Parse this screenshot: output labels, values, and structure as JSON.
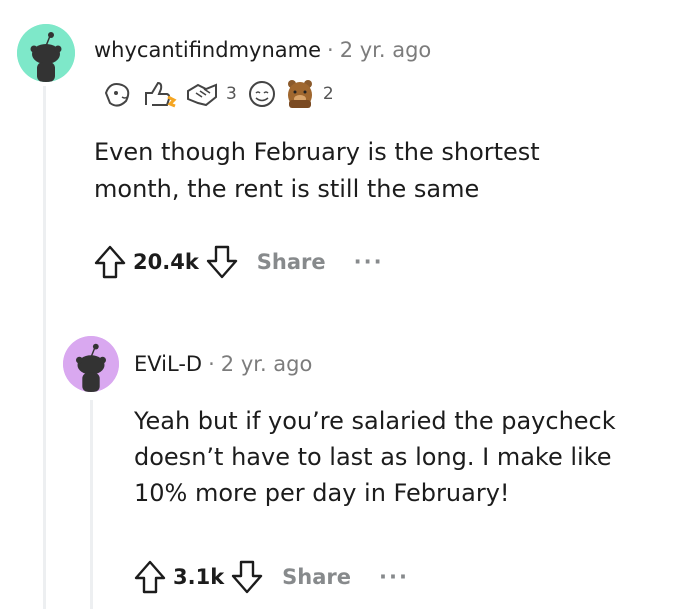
{
  "comments": [
    {
      "username": "whycantifindmyname",
      "separator": "·",
      "time": "2 yr. ago",
      "avatar_color": "#7ee8c9",
      "awards": [
        {
          "icon": "wholesome-seal-award-icon",
          "count": ""
        },
        {
          "icon": "thumbs-up-award-icon",
          "count": ""
        },
        {
          "icon": "handshake-award-icon",
          "count": "3"
        },
        {
          "icon": "smiling-face-award-icon",
          "count": ""
        },
        {
          "icon": "bear-facepalm-award-icon",
          "count": "2"
        }
      ],
      "body_lines": [
        "Even though February is the shortest",
        "month, the rent is still the same"
      ],
      "score": "20.4k",
      "share_label": "Share",
      "more_label": "···"
    },
    {
      "username": "EViL-D",
      "separator": "·",
      "time": "2 yr. ago",
      "avatar_color": "#d9a8f0",
      "awards": [],
      "body_lines": [
        "Yeah but if you’re salaried the paycheck",
        "doesn’t have to last as long. I make like",
        "10% more per day in February!"
      ],
      "score": "3.1k",
      "share_label": "Share",
      "more_label": "···"
    }
  ],
  "colors": {
    "thread_line": "#edeff1",
    "muted": "#7c7c7c",
    "action_gray": "#878a8c"
  }
}
